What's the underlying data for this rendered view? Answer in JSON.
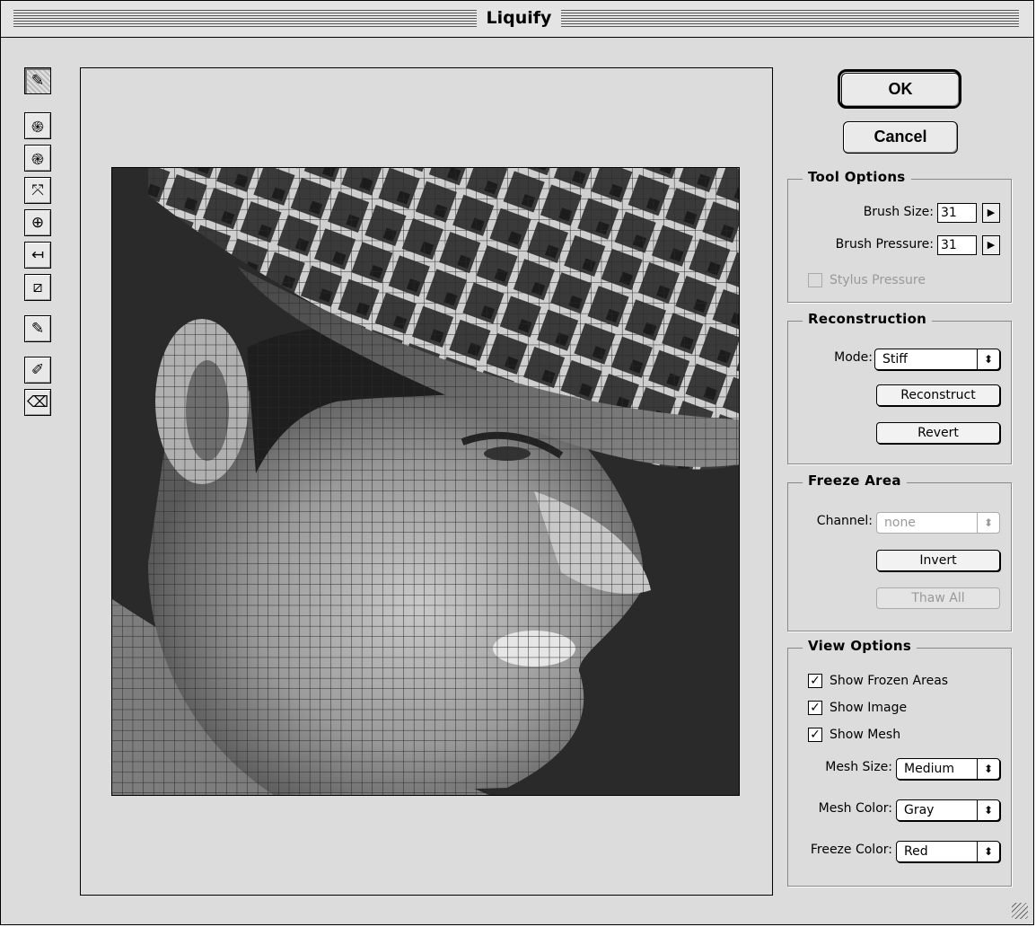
{
  "window": {
    "title": "Liquify"
  },
  "tools": [
    {
      "icon": "warp-brush-icon",
      "glyph": "✎",
      "active": true
    },
    {
      "icon": "twirl-clockwise-icon",
      "glyph": "֍"
    },
    {
      "icon": "twirl-counterclockwise-icon",
      "glyph": "֎"
    },
    {
      "icon": "pucker-icon",
      "glyph": "⤧"
    },
    {
      "icon": "bloat-icon",
      "glyph": "⊕"
    },
    {
      "icon": "shift-pixels-icon",
      "glyph": "↤"
    },
    {
      "icon": "reflection-icon",
      "glyph": "⧄"
    },
    {
      "icon": "reconstruct-brush-icon",
      "glyph": "✎"
    },
    {
      "icon": "freeze-brush-icon",
      "glyph": "✐"
    },
    {
      "icon": "thaw-eraser-icon",
      "glyph": "⌫"
    }
  ],
  "buttons": {
    "ok": "OK",
    "cancel": "Cancel"
  },
  "tool_options": {
    "title": "Tool Options",
    "brush_size_label": "Brush Size:",
    "brush_size_value": "31",
    "brush_pressure_label": "Brush Pressure:",
    "brush_pressure_value": "31",
    "stylus_pressure_label": "Stylus Pressure",
    "stylus_pressure_checked": false
  },
  "reconstruction": {
    "title": "Reconstruction",
    "mode_label": "Mode:",
    "mode_value": "Stiff",
    "reconstruct_label": "Reconstruct",
    "revert_label": "Revert"
  },
  "freeze_area": {
    "title": "Freeze Area",
    "channel_label": "Channel:",
    "channel_value": "none",
    "invert_label": "Invert",
    "thaw_all_label": "Thaw All"
  },
  "view_options": {
    "title": "View Options",
    "show_frozen_areas": "Show Frozen Areas",
    "show_image": "Show Image",
    "show_mesh": "Show Mesh",
    "checkmark": "✓",
    "mesh_size_label": "Mesh Size:",
    "mesh_size_value": "Medium",
    "mesh_color_label": "Mesh Color:",
    "mesh_color_value": "Gray",
    "freeze_color_label": "Freeze Color:",
    "freeze_color_value": "Red"
  },
  "glyphs": {
    "arrow_right": "▶",
    "updown": "⬍"
  },
  "colors": {
    "dialog_bg": "#dcdcdc",
    "mesh": "#2a2a2a"
  }
}
